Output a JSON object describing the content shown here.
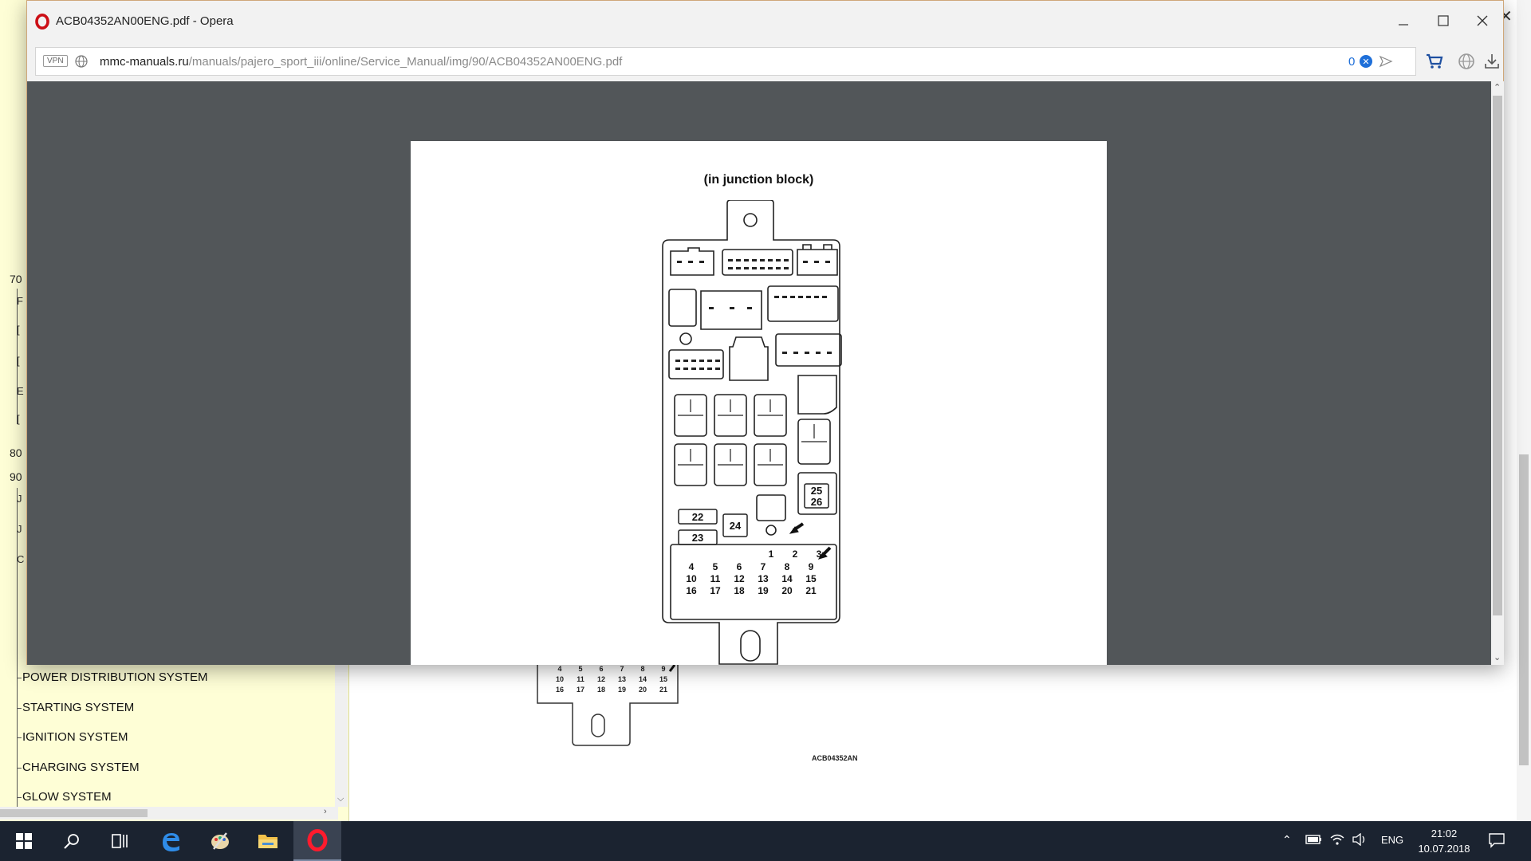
{
  "background_page": {
    "tree_numbers": [
      "70",
      "80",
      "90"
    ],
    "tree_stubs": [
      "F",
      "[",
      "[",
      "E",
      "[",
      "J",
      "J",
      "C"
    ],
    "menu_items": [
      "POWER DISTRIBUTION SYSTEM",
      "STARTING SYSTEM",
      "IGNITION SYSTEM",
      "CHARGING SYSTEM",
      "GLOW SYSTEM"
    ],
    "diagram_code": "ACB04352AN",
    "fuse_rows": [
      [
        "4",
        "5",
        "6",
        "7",
        "8",
        "9"
      ],
      [
        "10",
        "11",
        "12",
        "13",
        "14",
        "15"
      ],
      [
        "16",
        "17",
        "18",
        "19",
        "20",
        "21"
      ]
    ]
  },
  "popup": {
    "title": "ACB04352AN00ENG.pdf - Opera",
    "address_bar": {
      "vpn_label": "VPN",
      "url_host": "mmc-manuals.ru",
      "url_path": "/manuals/pajero_sport_iii/online/Service_Manual/img/90/ACB04352AN00ENG.pdf",
      "adblock_count": "0"
    },
    "window_buttons": [
      "minimize",
      "maximize",
      "close"
    ],
    "pdf": {
      "heading": "(in junction block)",
      "relay_labels": [
        "25",
        "26",
        "22",
        "23",
        "24"
      ],
      "fuse_top_row": [
        "1",
        "2",
        "3"
      ],
      "fuse_rows": [
        [
          "4",
          "5",
          "6",
          "7",
          "8",
          "9"
        ],
        [
          "10",
          "11",
          "12",
          "13",
          "14",
          "15"
        ],
        [
          "16",
          "17",
          "18",
          "19",
          "20",
          "21"
        ]
      ]
    }
  },
  "taskbar": {
    "language": "ENG",
    "time": "21:02",
    "date": "10.07.2018"
  },
  "colors": {
    "opera_red": "#cc0f16",
    "viewer_bg": "#525659",
    "sidebar_bg": "#fefed6",
    "taskbar_bg": "#1b2330",
    "adblock_blue": "#1e6fd9"
  }
}
